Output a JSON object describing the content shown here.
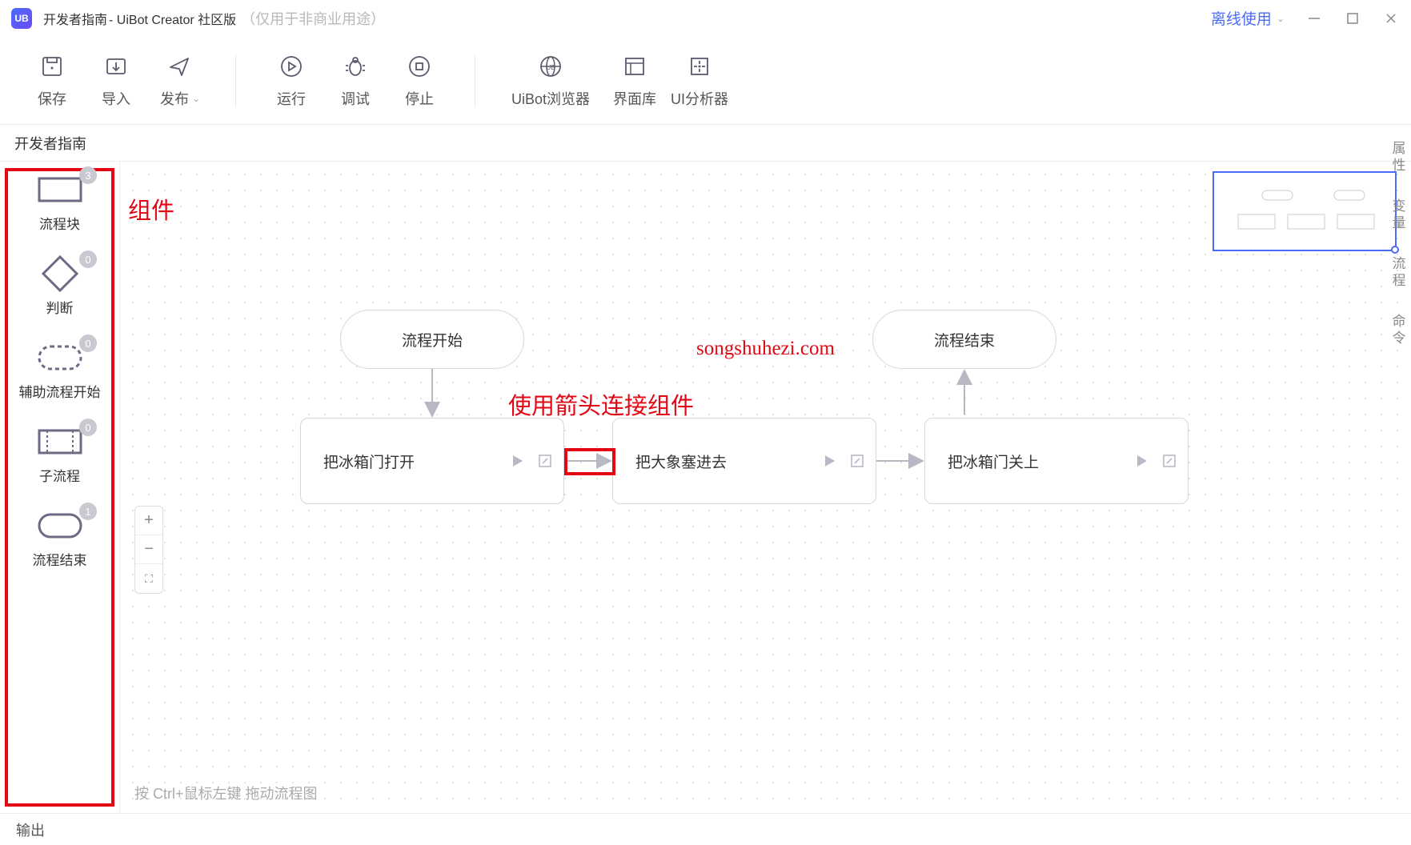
{
  "title": {
    "doc": "开发者指南",
    "app": " - UiBot Creator 社区版",
    "note": "（仅用于非商业用途）"
  },
  "offline": "离线使用",
  "toolbar": {
    "save": "保存",
    "import": "导入",
    "publish": "发布",
    "run": "运行",
    "debug": "调试",
    "stop": "停止",
    "browser": "UiBot浏览器",
    "uilib": "界面库",
    "analyzer": "UI分析器"
  },
  "tab": "开发者指南",
  "components": {
    "block": {
      "label": "流程块",
      "badge": "3"
    },
    "decision": {
      "label": "判断",
      "badge": "0"
    },
    "auxstart": {
      "label": "辅助流程开始",
      "badge": "0"
    },
    "subflow": {
      "label": "子流程",
      "badge": "0"
    },
    "end": {
      "label": "流程结束",
      "badge": "1"
    }
  },
  "nodes": {
    "start": "流程开始",
    "step1": "把冰箱门打开",
    "step2": "把大象塞进去",
    "step3": "把冰箱门关上",
    "end": "流程结束"
  },
  "annotations": {
    "components": "组件",
    "arrows": "使用箭头连接组件",
    "watermark": "songshuhezi.com"
  },
  "hint": "按 Ctrl+鼠标左键 拖动流程图",
  "rightrail": {
    "prop": "属性",
    "var": "变量",
    "flow": "流程",
    "cmd": "命令"
  },
  "bottom": "输出",
  "zoom": {
    "in": "+",
    "out": "−",
    "fit": "⛶"
  }
}
